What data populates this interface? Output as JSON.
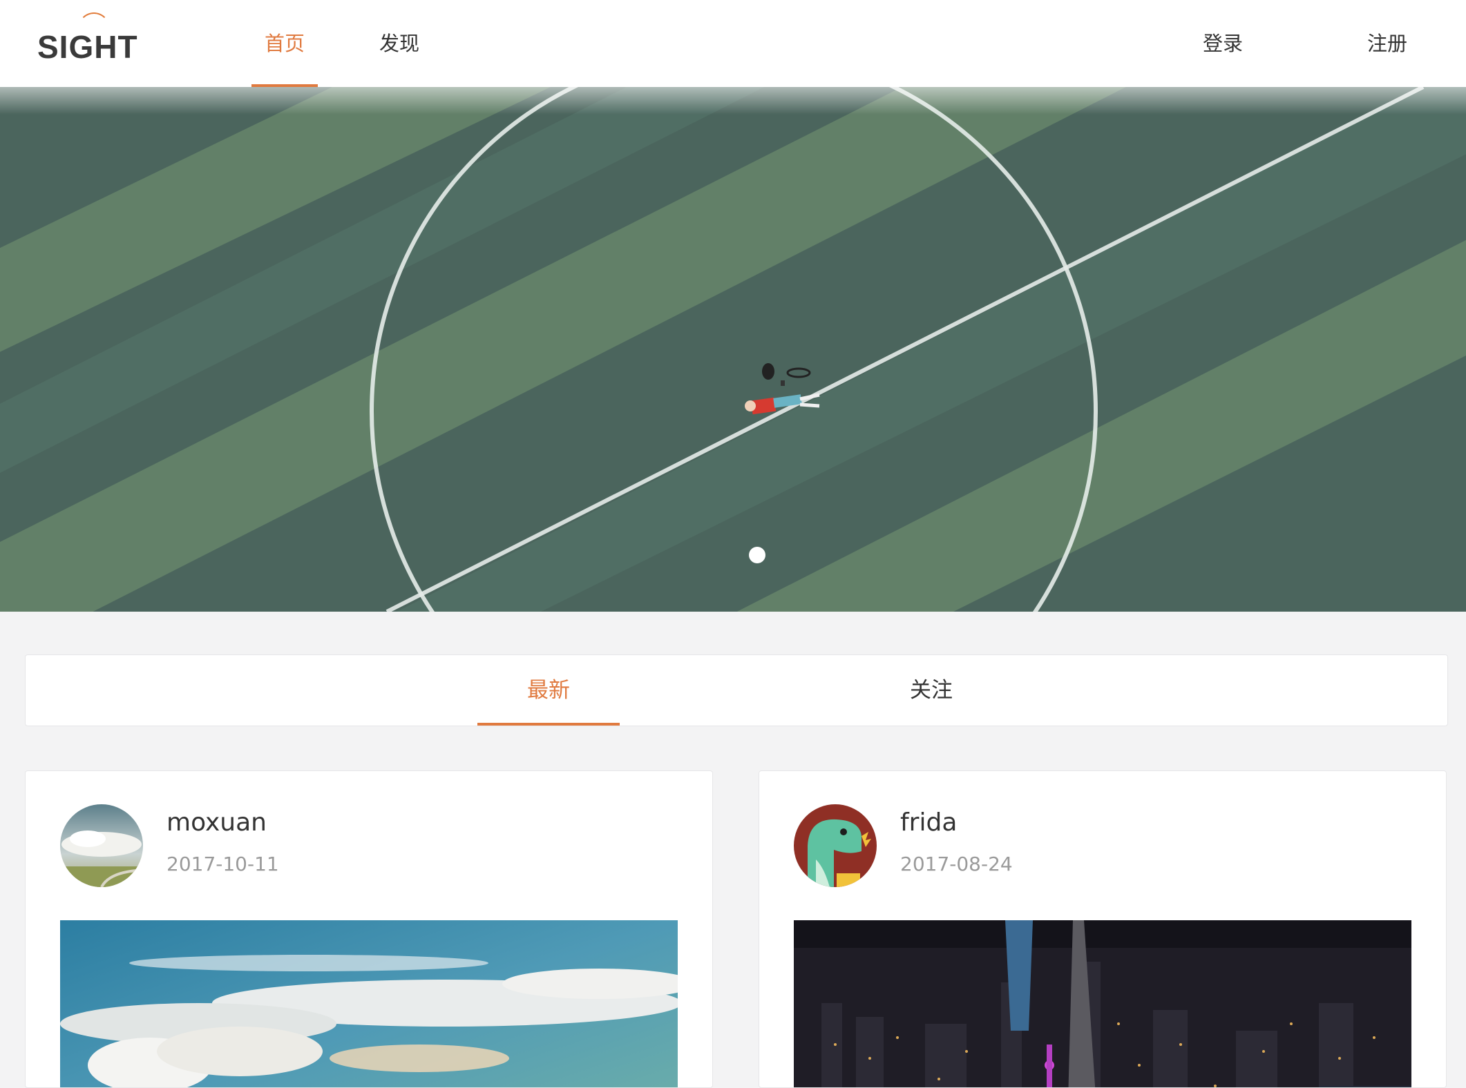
{
  "header": {
    "logo": "SIGHT",
    "nav": {
      "home": "首页",
      "discover": "发现"
    },
    "login": "登录",
    "register": "注册"
  },
  "banner": {
    "image": "aerial-football-field-person-lying",
    "slide_count": 1,
    "active_slide": 1
  },
  "tabs": {
    "latest": "最新",
    "follow": "关注",
    "active": "latest"
  },
  "posts": [
    {
      "username": "moxuan",
      "date": "2017-10-11",
      "avatar": "cloud-landscape-avatar",
      "image": "sky-clouds-photo"
    },
    {
      "username": "frida",
      "date": "2017-08-24",
      "avatar": "green-dinosaur-avatar",
      "image": "city-night-skyline-photo"
    }
  ],
  "colors": {
    "accent": "#e07a3f",
    "background": "#f3f3f4",
    "text": "#333333",
    "muted": "#9a9a9a"
  }
}
